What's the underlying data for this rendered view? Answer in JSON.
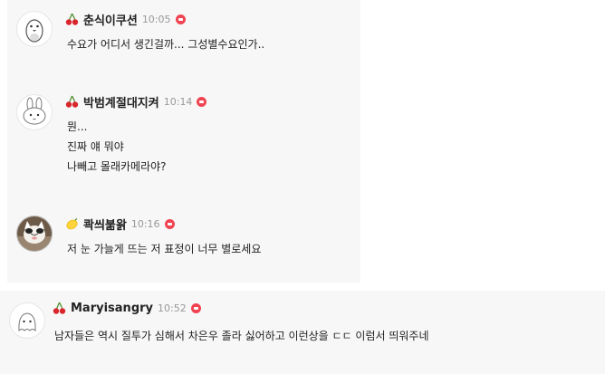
{
  "comments": [
    {
      "nickname": "춘식이쿠션",
      "time": "10:05",
      "badge": "cherry",
      "avatar": "penguin-avatar",
      "lines": [
        "수요가 어디서 생긴걸까... 그성별수요인가.."
      ]
    },
    {
      "nickname": "박범계절대지켜",
      "time": "10:14",
      "badge": "cherry",
      "avatar": "rabbit-avatar",
      "lines": [
        "뭔...",
        "진짜 얘 뭐야",
        "나빼고 몰래카메라야?"
      ]
    },
    {
      "nickname": "콱씌붊왉",
      "time": "10:16",
      "badge": "lemon",
      "avatar": "cat-photo-avatar",
      "lines": [
        "저 눈 가늘게 뜨는 저 표정이 너무 별로세요"
      ]
    },
    {
      "nickname": "Maryisangry",
      "time": "10:52",
      "badge": "cherry",
      "avatar": "ghost-avatar",
      "lines": [
        "남자들은 역시 질투가 심해서 차은우 졸라 싫어하고 이런상을 ㄷㄷ 이럼서 띄워주네"
      ]
    }
  ],
  "colors": {
    "new_badge": "#f04452",
    "panel": "#f7f7f7",
    "time": "#999999"
  }
}
